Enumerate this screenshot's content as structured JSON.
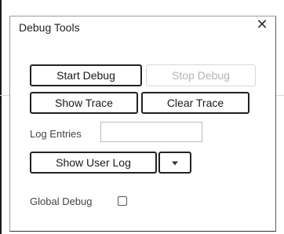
{
  "dialog": {
    "title": "Debug Tools",
    "close_glyph": "✕",
    "start_debug_label": "Start Debug",
    "stop_debug_label": "Stop Debug",
    "show_trace_label": "Show Trace",
    "clear_trace_label": "Clear Trace",
    "log_entries_label": "Log Entries",
    "log_entries_value": "",
    "show_user_log_label": "Show User Log",
    "global_debug_label": "Global Debug",
    "global_debug_checked": false
  },
  "icons": {
    "close": "close-icon",
    "dropdown": "chevron-down-icon"
  }
}
